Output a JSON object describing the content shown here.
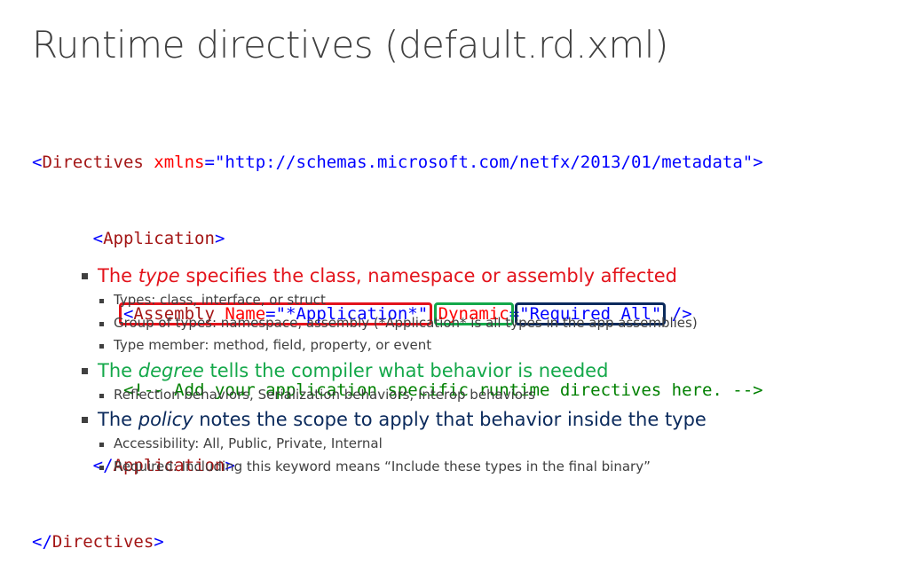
{
  "title": "Runtime directives (default.rd.xml)",
  "code": {
    "line1": {
      "open": "<",
      "tag": "Directives",
      "attr": "xmlns",
      "eq": "=",
      "value": "\"http://schemas.microsoft.com/netfx/2013/01/metadata\"",
      "close": ">"
    },
    "line2": {
      "open": "<",
      "tag": "Application",
      "close": ">"
    },
    "line3": {
      "open": "<",
      "tag": "Assembly",
      "attr1": "Name",
      "eq1": "=",
      "val1": "\"*Application*\"",
      "attr2": "Dynamic",
      "eq2": "=",
      "val2": "\"Required All\"",
      "close": "/>"
    },
    "line4": "<!-- Add your application specific runtime directives here. -->",
    "line5": {
      "open": "</",
      "tag": "Application",
      "close": ">"
    },
    "line6": {
      "open": "</",
      "tag": "Directives",
      "close": ">"
    }
  },
  "bullets": {
    "type": {
      "pre": "The ",
      "em": "type",
      "post": " specifies the class, namespace or assembly affected",
      "color": "#e3131b",
      "sub": [
        "Types: class, interface, or struct",
        "Group of types: namespace, assembly (*Application* is all types in the app assemblies)",
        "Type member: method, field, property, or event"
      ]
    },
    "degree": {
      "pre": "The ",
      "em": "degree",
      "post": " tells the compiler what behavior is needed",
      "color": "#14a84a",
      "sub": [
        "Reflection behaviors, Serialization behaviors, Interop behaviors"
      ]
    },
    "policy": {
      "pre": "The ",
      "em": "policy",
      "post": " notes the scope to apply that behavior inside the type",
      "color": "#0b2a5c",
      "sub": [
        "Accessibility: All, Public, Private, Internal",
        "Required: Including this keyword means “Include these types in the final binary”"
      ]
    }
  }
}
